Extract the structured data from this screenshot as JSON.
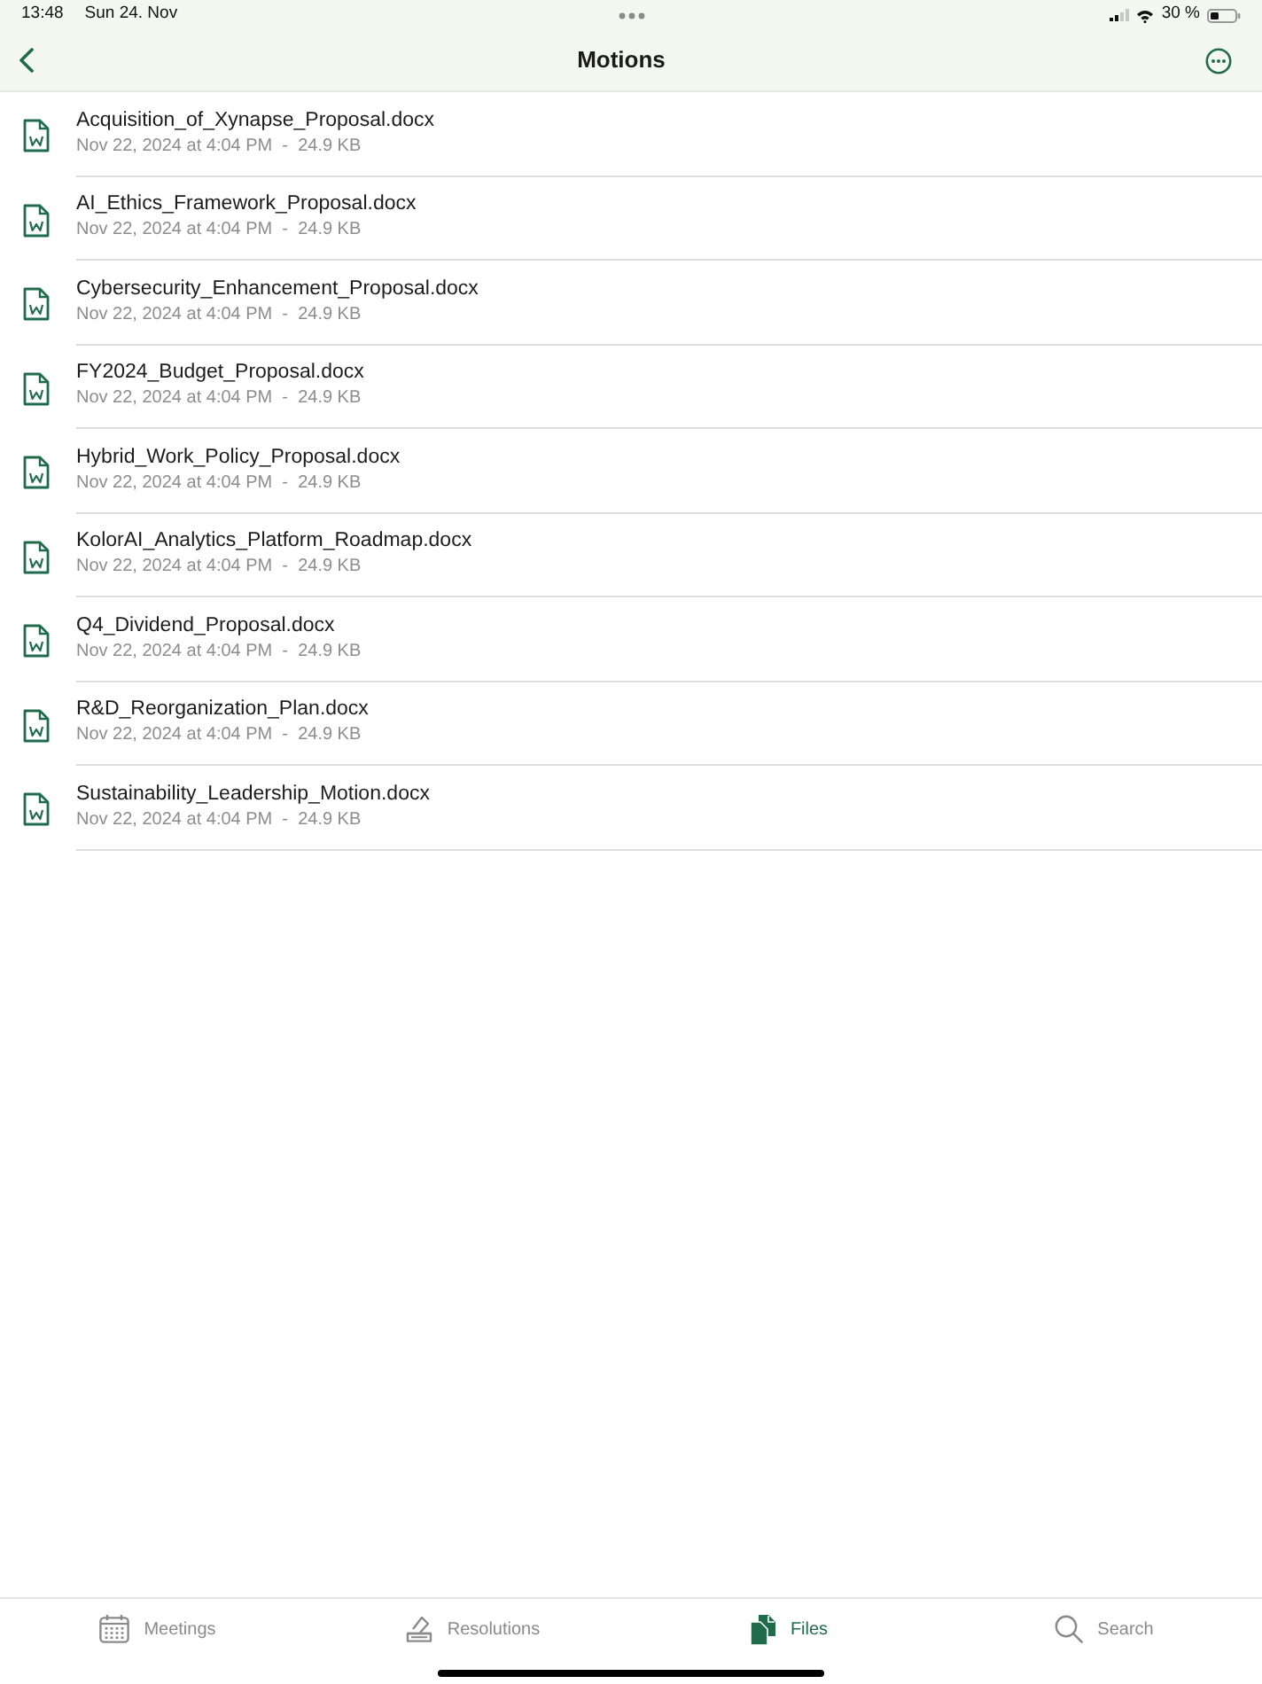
{
  "status_bar": {
    "time": "13:48",
    "date": "Sun 24. Nov",
    "battery": "30 %"
  },
  "nav_bar": {
    "title": "Motions"
  },
  "files": [
    {
      "name": "Acquisition_of_Xynapse_Proposal.docx",
      "meta": "Nov 22, 2024 at 4:04 PM  -  24.9 KB"
    },
    {
      "name": "AI_Ethics_Framework_Proposal.docx",
      "meta": "Nov 22, 2024 at 4:04 PM  -  24.9 KB"
    },
    {
      "name": "Cybersecurity_Enhancement_Proposal.docx",
      "meta": "Nov 22, 2024 at 4:04 PM  -  24.9 KB"
    },
    {
      "name": "FY2024_Budget_Proposal.docx",
      "meta": "Nov 22, 2024 at 4:04 PM  -  24.9 KB"
    },
    {
      "name": "Hybrid_Work_Policy_Proposal.docx",
      "meta": "Nov 22, 2024 at 4:04 PM  -  24.9 KB"
    },
    {
      "name": "KolorAI_Analytics_Platform_Roadmap.docx",
      "meta": "Nov 22, 2024 at 4:04 PM  -  24.9 KB"
    },
    {
      "name": "Q4_Dividend_Proposal.docx",
      "meta": "Nov 22, 2024 at 4:04 PM  -  24.9 KB"
    },
    {
      "name": "R&D_Reorganization_Plan.docx",
      "meta": "Nov 22, 2024 at 4:04 PM  -  24.9 KB"
    },
    {
      "name": "Sustainability_Leadership_Motion.docx",
      "meta": "Nov 22, 2024 at 4:04 PM  -  24.9 KB"
    }
  ],
  "tab_bar": [
    {
      "label": "Meetings",
      "selected": false
    },
    {
      "label": "Resolutions",
      "selected": false
    },
    {
      "label": "Files",
      "selected": true
    },
    {
      "label": "Search",
      "selected": false
    }
  ]
}
